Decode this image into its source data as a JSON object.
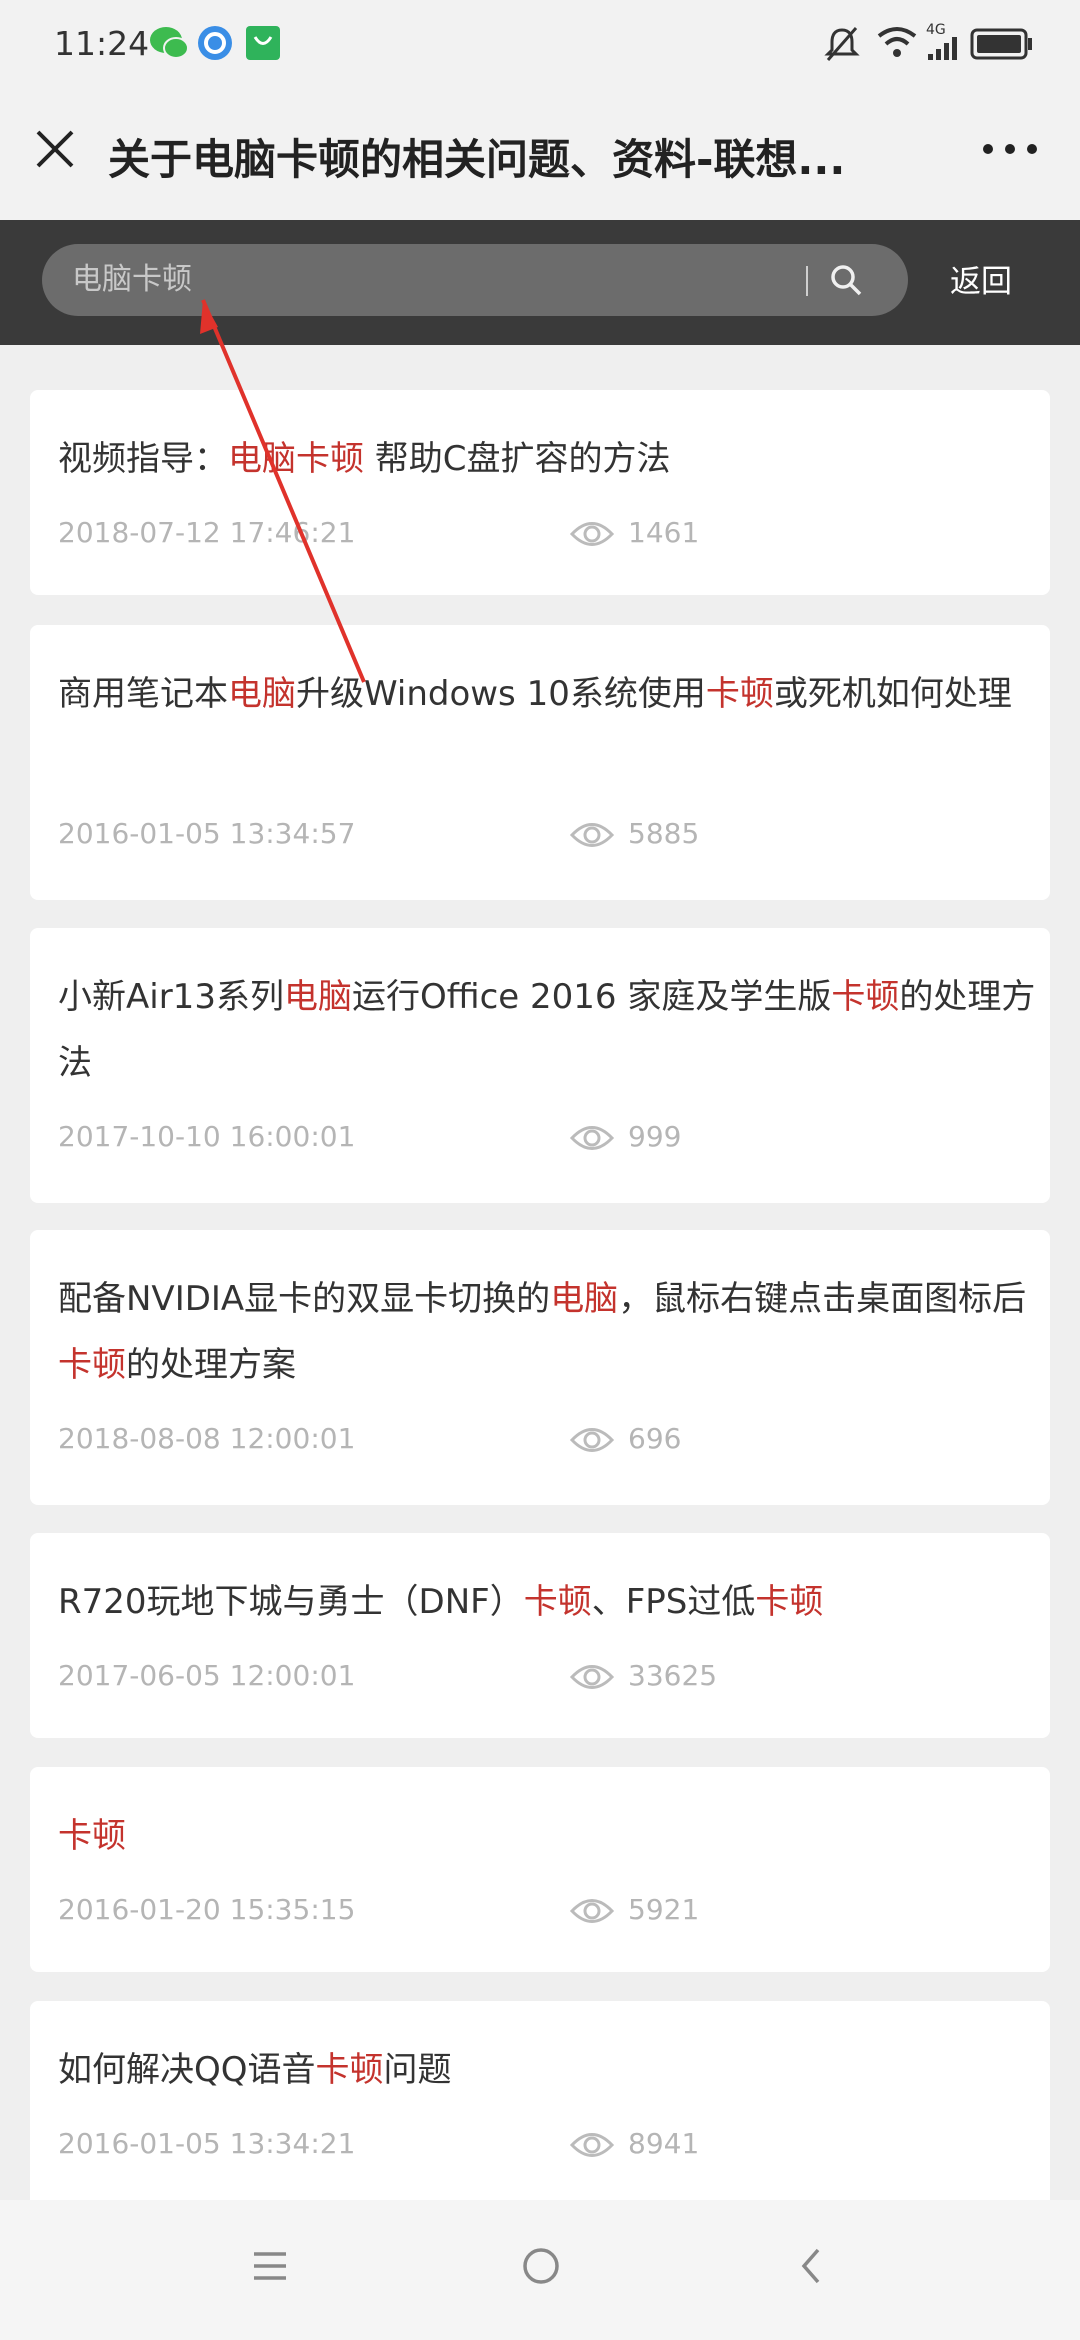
{
  "status_bar": {
    "time": "11:24",
    "network": "4G"
  },
  "header": {
    "title": "关于电脑卡顿的相关问题、资料-联想..."
  },
  "search": {
    "value": "电脑卡顿",
    "back_label": "返回"
  },
  "colors": {
    "highlight": "#c4332d",
    "search_band": "#3a3a3a",
    "annotation_arrow": "#e0322b"
  },
  "items": [
    {
      "segments": [
        [
          "视频指导：",
          false
        ],
        [
          "电脑卡顿",
          true
        ],
        [
          " 帮助C盘扩容的方法",
          false
        ]
      ],
      "date": "2018-07-12 17:46:21",
      "views": "1461"
    },
    {
      "segments": [
        [
          "商用笔记本",
          false
        ],
        [
          "电脑",
          true
        ],
        [
          "升级Windows 10系统使用",
          false
        ],
        [
          "卡顿",
          true
        ],
        [
          "或死机如何处理",
          false
        ]
      ],
      "date": "2016-01-05 13:34:57",
      "views": "5885"
    },
    {
      "segments": [
        [
          "小新Air13系列",
          false
        ],
        [
          "电脑",
          true
        ],
        [
          "运行Office 2016 家庭及学生版",
          false
        ],
        [
          "卡顿",
          true
        ],
        [
          "的处理方法",
          false
        ]
      ],
      "date": "2017-10-10 16:00:01",
      "views": "999"
    },
    {
      "segments": [
        [
          "配备NVIDIA显卡的双显卡切换的",
          false
        ],
        [
          "电脑",
          true
        ],
        [
          "，鼠标右键点击桌面图标后",
          false
        ],
        [
          "卡顿",
          true
        ],
        [
          "的处理方案",
          false
        ]
      ],
      "date": "2018-08-08 12:00:01",
      "views": "696"
    },
    {
      "segments": [
        [
          "R720玩地下城与勇士（DNF）",
          false
        ],
        [
          "卡顿",
          true
        ],
        [
          "、FPS过低",
          false
        ],
        [
          "卡顿",
          true
        ]
      ],
      "date": "2017-06-05 12:00:01",
      "views": "33625"
    },
    {
      "segments": [
        [
          "卡顿",
          true
        ]
      ],
      "date": "2016-01-20 15:35:15",
      "views": "5921"
    },
    {
      "segments": [
        [
          "如何解决QQ语音",
          false
        ],
        [
          "卡顿",
          true
        ],
        [
          "问题",
          false
        ]
      ],
      "date": "2016-01-05 13:34:21",
      "views": "8941"
    }
  ]
}
